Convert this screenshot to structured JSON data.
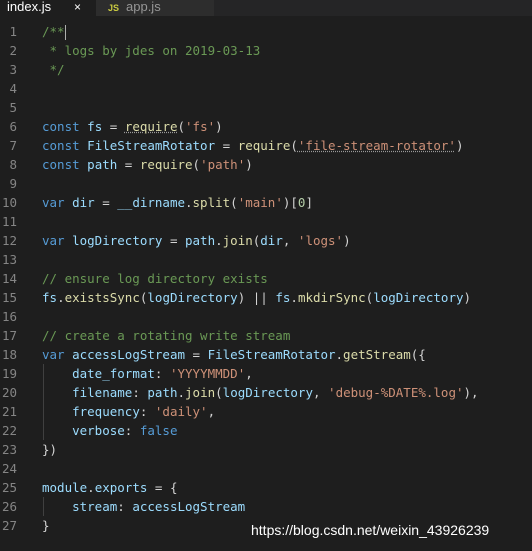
{
  "tabs": [
    {
      "label": "index.js",
      "active": true,
      "close_glyph": "×"
    },
    {
      "label": "app.js",
      "active": false,
      "badge": "JS"
    }
  ],
  "lines": [
    {
      "n": "1",
      "tokens": [
        [
          "/**",
          "comment"
        ]
      ]
    },
    {
      "n": "2",
      "tokens": [
        [
          " * logs by jdes on 2019-03-13",
          "comment"
        ]
      ]
    },
    {
      "n": "3",
      "tokens": [
        [
          " */",
          "comment"
        ]
      ]
    },
    {
      "n": "4",
      "tokens": []
    },
    {
      "n": "5",
      "tokens": []
    },
    {
      "n": "6",
      "tokens": [
        [
          "const",
          "kw"
        ],
        [
          " ",
          "plain"
        ],
        [
          "fs",
          "var"
        ],
        [
          " = ",
          "plain"
        ],
        [
          "require",
          "fn dotted"
        ],
        [
          "(",
          "plain"
        ],
        [
          "'fs'",
          "str"
        ],
        [
          ")",
          "plain"
        ]
      ]
    },
    {
      "n": "7",
      "tokens": [
        [
          "const",
          "kw"
        ],
        [
          " ",
          "plain"
        ],
        [
          "FileStreamRotator",
          "var"
        ],
        [
          " = ",
          "plain"
        ],
        [
          "require",
          "fn"
        ],
        [
          "(",
          "plain"
        ],
        [
          "'file-stream-rotator'",
          "str dotted"
        ],
        [
          ")",
          "plain"
        ]
      ]
    },
    {
      "n": "8",
      "tokens": [
        [
          "const",
          "kw"
        ],
        [
          " ",
          "plain"
        ],
        [
          "path",
          "var"
        ],
        [
          " = ",
          "plain"
        ],
        [
          "require",
          "fn"
        ],
        [
          "(",
          "plain"
        ],
        [
          "'path'",
          "str"
        ],
        [
          ")",
          "plain"
        ]
      ]
    },
    {
      "n": "9",
      "tokens": []
    },
    {
      "n": "10",
      "tokens": [
        [
          "var",
          "kw"
        ],
        [
          " ",
          "plain"
        ],
        [
          "dir",
          "var"
        ],
        [
          " = ",
          "plain"
        ],
        [
          "__dirname",
          "var"
        ],
        [
          ".",
          "plain"
        ],
        [
          "split",
          "fn"
        ],
        [
          "(",
          "plain"
        ],
        [
          "'main'",
          "str"
        ],
        [
          ")[",
          "plain"
        ],
        [
          "0",
          "num"
        ],
        [
          "]",
          "plain"
        ]
      ]
    },
    {
      "n": "11",
      "tokens": []
    },
    {
      "n": "12",
      "tokens": [
        [
          "var",
          "kw"
        ],
        [
          " ",
          "plain"
        ],
        [
          "logDirectory",
          "var"
        ],
        [
          " = ",
          "plain"
        ],
        [
          "path",
          "var"
        ],
        [
          ".",
          "plain"
        ],
        [
          "join",
          "fn"
        ],
        [
          "(",
          "plain"
        ],
        [
          "dir",
          "var"
        ],
        [
          ", ",
          "plain"
        ],
        [
          "'logs'",
          "str"
        ],
        [
          ")",
          "plain"
        ]
      ]
    },
    {
      "n": "13",
      "tokens": []
    },
    {
      "n": "14",
      "tokens": [
        [
          "// ensure log directory exists",
          "comment"
        ]
      ]
    },
    {
      "n": "15",
      "tokens": [
        [
          "fs",
          "var"
        ],
        [
          ".",
          "plain"
        ],
        [
          "existsSync",
          "fn"
        ],
        [
          "(",
          "plain"
        ],
        [
          "logDirectory",
          "var"
        ],
        [
          ") || ",
          "plain"
        ],
        [
          "fs",
          "var"
        ],
        [
          ".",
          "plain"
        ],
        [
          "mkdirSync",
          "fn"
        ],
        [
          "(",
          "plain"
        ],
        [
          "logDirectory",
          "var"
        ],
        [
          ")",
          "plain"
        ]
      ]
    },
    {
      "n": "16",
      "tokens": []
    },
    {
      "n": "17",
      "tokens": [
        [
          "// create a rotating write stream",
          "comment"
        ]
      ]
    },
    {
      "n": "18",
      "tokens": [
        [
          "var",
          "kw"
        ],
        [
          " ",
          "plain"
        ],
        [
          "accessLogStream",
          "var"
        ],
        [
          " = ",
          "plain"
        ],
        [
          "FileStreamRotator",
          "var"
        ],
        [
          ".",
          "plain"
        ],
        [
          "getStream",
          "fn"
        ],
        [
          "({",
          "plain"
        ]
      ]
    },
    {
      "n": "19",
      "tokens": [
        [
          "    ",
          "plain"
        ],
        [
          "date_format",
          "var"
        ],
        [
          ": ",
          "plain"
        ],
        [
          "'YYYYMMDD'",
          "str"
        ],
        [
          ",",
          "plain"
        ]
      ]
    },
    {
      "n": "20",
      "tokens": [
        [
          "    ",
          "plain"
        ],
        [
          "filename",
          "var"
        ],
        [
          ": ",
          "plain"
        ],
        [
          "path",
          "var"
        ],
        [
          ".",
          "plain"
        ],
        [
          "join",
          "fn"
        ],
        [
          "(",
          "plain"
        ],
        [
          "logDirectory",
          "var"
        ],
        [
          ", ",
          "plain"
        ],
        [
          "'debug-%DATE%.log'",
          "str"
        ],
        [
          "),",
          "plain"
        ]
      ]
    },
    {
      "n": "21",
      "tokens": [
        [
          "    ",
          "plain"
        ],
        [
          "frequency",
          "var"
        ],
        [
          ": ",
          "plain"
        ],
        [
          "'daily'",
          "str"
        ],
        [
          ",",
          "plain"
        ]
      ]
    },
    {
      "n": "22",
      "tokens": [
        [
          "    ",
          "plain"
        ],
        [
          "verbose",
          "var"
        ],
        [
          ": ",
          "plain"
        ],
        [
          "false",
          "kw"
        ]
      ]
    },
    {
      "n": "23",
      "tokens": [
        [
          "})",
          "plain"
        ]
      ]
    },
    {
      "n": "24",
      "tokens": []
    },
    {
      "n": "25",
      "tokens": [
        [
          "module",
          "var"
        ],
        [
          ".",
          "plain"
        ],
        [
          "exports",
          "var"
        ],
        [
          " = {",
          "plain"
        ]
      ]
    },
    {
      "n": "26",
      "tokens": [
        [
          "    ",
          "plain"
        ],
        [
          "stream",
          "var"
        ],
        [
          ": ",
          "plain"
        ],
        [
          "accessLogStream",
          "var"
        ]
      ]
    },
    {
      "n": "27",
      "tokens": [
        [
          "}",
          "plain"
        ]
      ]
    }
  ],
  "watermark": "https://blog.csdn.net/weixin_43926239",
  "colors": {
    "background": "#1e1e1e",
    "comment": "#6a9955",
    "keyword": "#569cd6",
    "variable": "#9cdcfe",
    "string": "#ce9178",
    "function": "#dcdcaa",
    "number": "#b5cea8",
    "line_number": "#858585"
  }
}
